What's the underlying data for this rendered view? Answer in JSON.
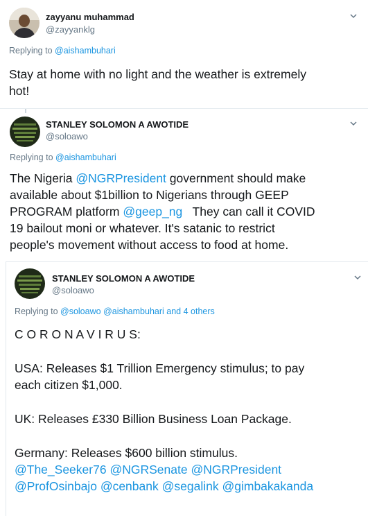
{
  "tweets": [
    {
      "name": "zayyanu muhammad",
      "handle": "@zayyanklg",
      "replying_prefix": "Replying to ",
      "replying_to": [
        "@aishambuhari"
      ],
      "replying_suffix": "",
      "body_lines": [
        "Stay at home with no light and the weather is extremely",
        "hot!"
      ]
    },
    {
      "name": "STANLEY SOLOMON A AWOTIDE",
      "handle": "@soloawo",
      "replying_prefix": "Replying to ",
      "replying_to": [
        "@aishambuhari"
      ],
      "replying_suffix": "",
      "body": {
        "l1_a": "The Nigeria ",
        "l1_mention": "@NGRPresident",
        "l1_b": " government should make",
        "l2": "available about $1billion to Nigerians through GEEP",
        "l3_a": "PROGRAM platform ",
        "l3_mention": "@geep_ng",
        "l3_b": "   They can call it COVID",
        "l4": "19 bailout moni or whatever. It's satanic to restrict",
        "l5": "people's movement without access to food at home."
      }
    },
    {
      "name": "STANLEY SOLOMON A AWOTIDE",
      "handle": "@soloawo",
      "replying_prefix": "Replying to ",
      "replying_to": [
        "@soloawo",
        "@aishambuhari"
      ],
      "replying_suffix": " and 4 others",
      "body": {
        "l1": "C O R O N A V I R U S:",
        "l2": "USA: Releases $1 Trillion Emergency stimulus; to pay",
        "l3": "each citizen $1,000.",
        "l4": "UK: Releases £330 Billion Business Loan Package.",
        "l5": "Germany: Releases $600 billion stimulus.",
        "mentions_line1": [
          "@The_Seeker76",
          "@NGRSenate",
          "@NGRPresident"
        ],
        "mentions_line2": [
          "@ProfOsinbajo",
          "@cenbank",
          "@segalink",
          "@gimbakakanda"
        ]
      }
    }
  ],
  "icons": {
    "more": "chevron-down-icon"
  },
  "colors": {
    "link": "#1b95e0",
    "secondary": "#657786",
    "text": "#14171a",
    "divider": "#e6ecf0"
  }
}
